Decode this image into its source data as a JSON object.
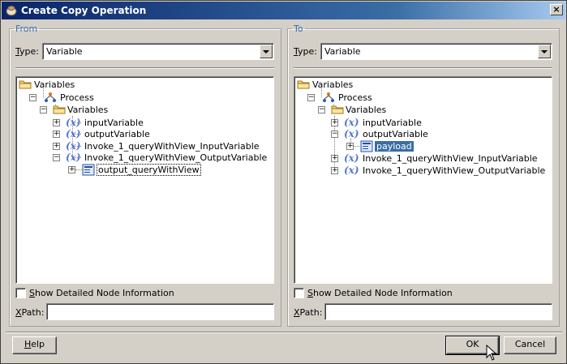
{
  "window": {
    "title": "Create Copy Operation",
    "close_glyph": "×",
    "icons": {
      "app": "oracle-jdeveloper-icon"
    }
  },
  "from_panel": {
    "legend": "From",
    "type_label_prefix": "T",
    "type_label_rest": "ype:",
    "type_value": "Variable",
    "tree": [
      {
        "label": "Variables",
        "icon": "folder-icon"
      },
      {
        "label": "Process",
        "icon": "process-icon"
      },
      {
        "label": "Variables",
        "icon": "folder-icon"
      },
      {
        "label": "inputVariable",
        "icon": "variable-icon"
      },
      {
        "label": "outputVariable",
        "icon": "variable-icon"
      },
      {
        "label": "Invoke_1_queryWithView_InputVariable",
        "icon": "variable-icon"
      },
      {
        "label": "Invoke_1_queryWithView_OutputVariable",
        "icon": "variable-icon"
      },
      {
        "label": "output_queryWithView",
        "icon": "message-part-icon",
        "state": "focused"
      }
    ],
    "show_detail_prefix": "S",
    "show_detail_rest": "how Detailed Node Information",
    "xpath_prefix": "X",
    "xpath_rest": "Path:",
    "xpath_value": ""
  },
  "to_panel": {
    "legend": "To",
    "type_label_prefix": "T",
    "type_label_rest": "ype:",
    "type_value": "Variable",
    "tree": [
      {
        "label": "Variables",
        "icon": "folder-icon"
      },
      {
        "label": "Process",
        "icon": "process-icon"
      },
      {
        "label": "Variables",
        "icon": "folder-icon"
      },
      {
        "label": "inputVariable",
        "icon": "variable-icon"
      },
      {
        "label": "outputVariable",
        "icon": "variable-icon"
      },
      {
        "label": "payload",
        "icon": "message-part-icon",
        "state": "selected"
      },
      {
        "label": "Invoke_1_queryWithView_InputVariable",
        "icon": "variable-icon"
      },
      {
        "label": "Invoke_1_queryWithView_OutputVariable",
        "icon": "variable-icon"
      }
    ],
    "show_detail_prefix": "S",
    "show_detail_rest": "how Detailed Node Information",
    "xpath_prefix": "X",
    "xpath_rest": "Path:",
    "xpath_value": ""
  },
  "buttons": {
    "help_prefix": "H",
    "help_rest": "elp",
    "ok": "OK",
    "cancel": "Cancel"
  },
  "glyphs": {
    "plus": "+",
    "minus": "−",
    "var": "(x)"
  }
}
